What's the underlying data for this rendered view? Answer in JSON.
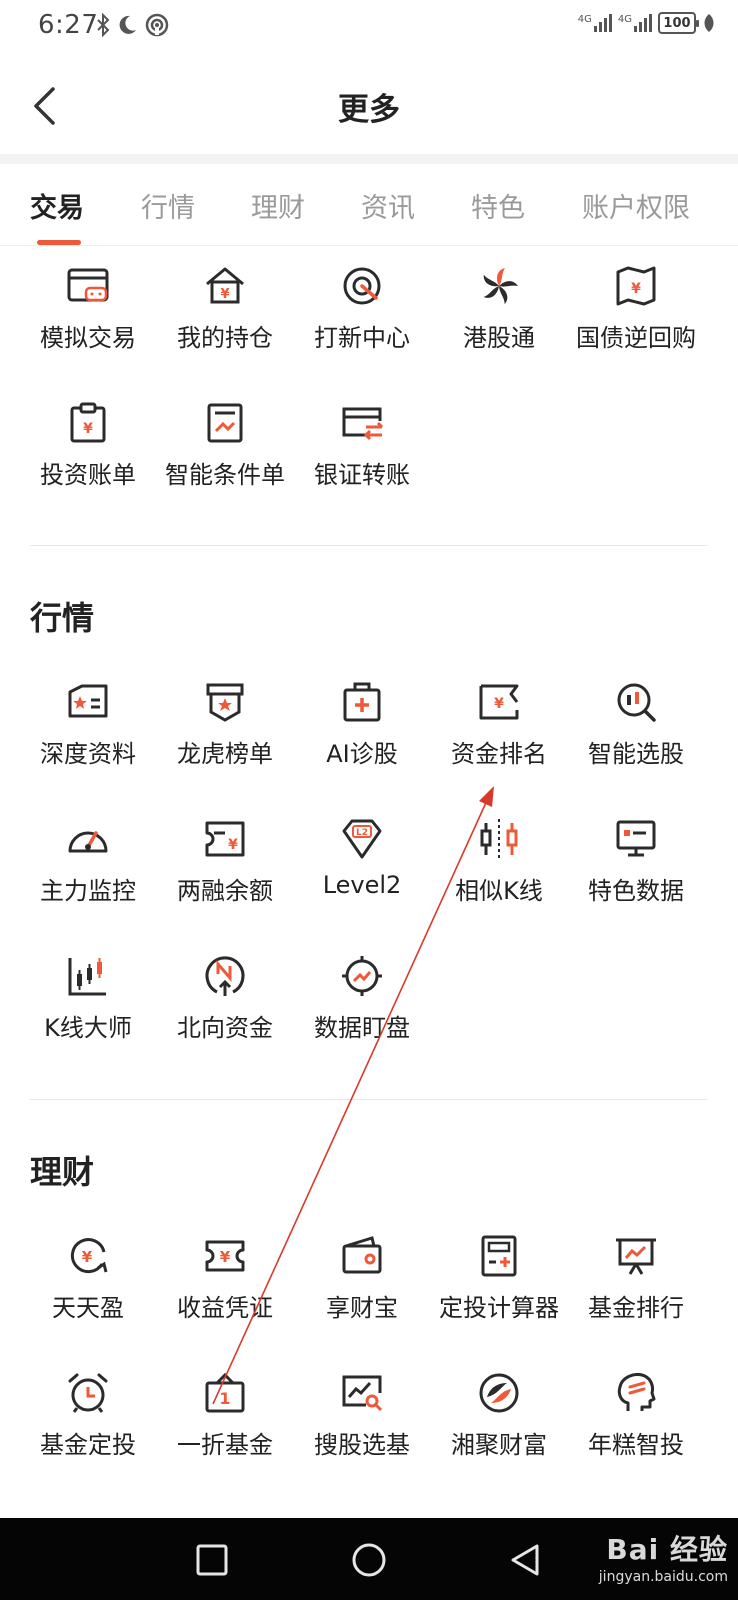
{
  "status": {
    "time": "6:27",
    "signal1": "4G",
    "signal2": "4G",
    "battery": "100"
  },
  "header": {
    "title": "更多"
  },
  "tabs": [
    {
      "label": "交易",
      "active": true
    },
    {
      "label": "行情",
      "active": false
    },
    {
      "label": "理财",
      "active": false
    },
    {
      "label": "资讯",
      "active": false
    },
    {
      "label": "特色",
      "active": false
    },
    {
      "label": "账户权限",
      "active": false
    }
  ],
  "sections": {
    "trade": {
      "items": [
        {
          "label": "模拟交易",
          "icon": "sim-trade-icon"
        },
        {
          "label": "我的持仓",
          "icon": "holdings-icon"
        },
        {
          "label": "打新中心",
          "icon": "ipo-center-icon"
        },
        {
          "label": "港股通",
          "icon": "hk-connect-icon"
        },
        {
          "label": "国债逆回购",
          "icon": "treasury-repo-icon"
        },
        {
          "label": "投资账单",
          "icon": "invest-bill-icon"
        },
        {
          "label": "智能条件单",
          "icon": "smart-order-icon"
        },
        {
          "label": "银证转账",
          "icon": "bank-transfer-icon"
        }
      ]
    },
    "market": {
      "title": "行情",
      "items": [
        {
          "label": "深度资料",
          "icon": "deep-data-icon"
        },
        {
          "label": "龙虎榜单",
          "icon": "dragon-tiger-icon"
        },
        {
          "label": "AI诊股",
          "icon": "ai-diagnosis-icon"
        },
        {
          "label": "资金排名",
          "icon": "fund-ranking-icon"
        },
        {
          "label": "智能选股",
          "icon": "smart-pick-icon"
        },
        {
          "label": "主力监控",
          "icon": "main-monitor-icon"
        },
        {
          "label": "两融余额",
          "icon": "margin-balance-icon"
        },
        {
          "label": "Level2",
          "icon": "level2-icon"
        },
        {
          "label": "相似K线",
          "icon": "similar-kline-icon"
        },
        {
          "label": "特色数据",
          "icon": "feature-data-icon"
        },
        {
          "label": "K线大师",
          "icon": "kline-master-icon"
        },
        {
          "label": "北向资金",
          "icon": "northbound-icon"
        },
        {
          "label": "数据盯盘",
          "icon": "data-watch-icon"
        }
      ]
    },
    "finance": {
      "title": "理财",
      "items": [
        {
          "label": "天天盈",
          "icon": "daily-profit-icon"
        },
        {
          "label": "收益凭证",
          "icon": "income-voucher-icon"
        },
        {
          "label": "享财宝",
          "icon": "wallet-icon"
        },
        {
          "label": "定投计算器",
          "icon": "calculator-icon"
        },
        {
          "label": "基金排行",
          "icon": "fund-rank-icon"
        },
        {
          "label": "基金定投",
          "icon": "alarm-clock-icon"
        },
        {
          "label": "一折基金",
          "icon": "discount-fund-icon"
        },
        {
          "label": "搜股选基",
          "icon": "search-fund-icon"
        },
        {
          "label": "湘聚财富",
          "icon": "xiangju-icon"
        },
        {
          "label": "年糕智投",
          "icon": "smart-invest-icon"
        }
      ]
    }
  },
  "watermark": {
    "main": "Bai 经验",
    "sub": "jingyan.baidu.com"
  },
  "colors": {
    "accent": "#ef5838",
    "icon_dark": "#2b2b2b",
    "nav_bg": "#050505"
  }
}
